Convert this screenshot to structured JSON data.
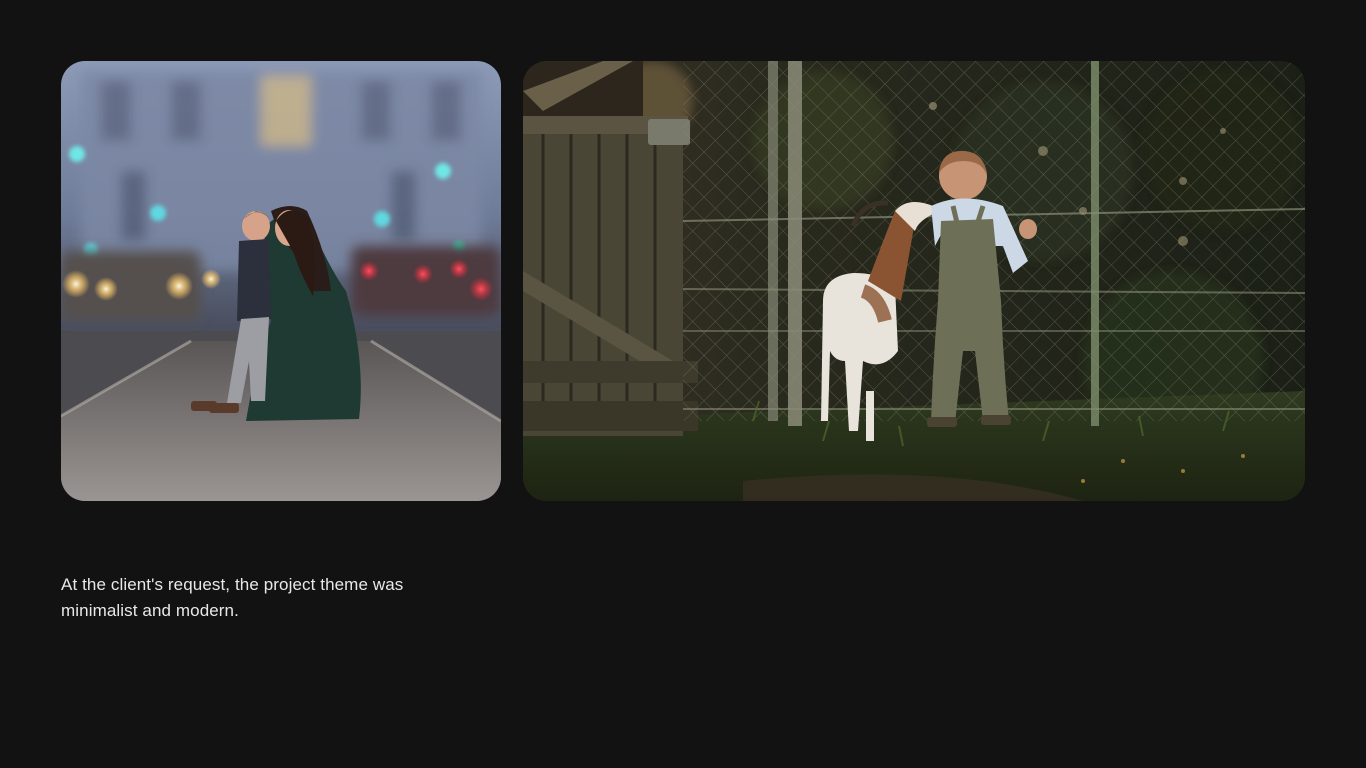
{
  "page": {
    "background": "#121212",
    "caption": "At the client's request, the project theme was minimalist and modern."
  },
  "photos": [
    {
      "name": "mother-and-son-city-street-photo",
      "subject": "mother kissing young boy on city sidewalk with bokeh lights"
    },
    {
      "name": "boy-and-goat-at-fence-photo",
      "subject": "young boy in overalls and goat looking through chain-link fence"
    }
  ]
}
